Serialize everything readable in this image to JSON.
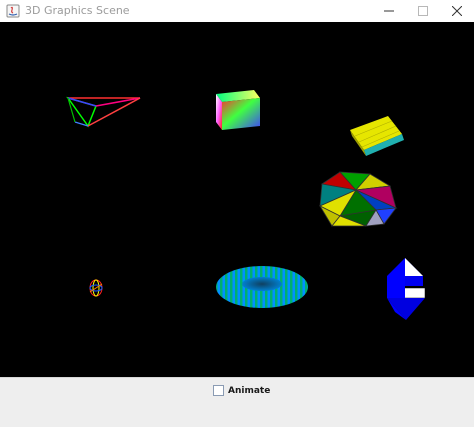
{
  "window": {
    "title": "3D Graphics Scene",
    "buttons": {
      "minimize": "minimize",
      "maximize": "maximize",
      "close": "close"
    }
  },
  "scene": {
    "background": "#000000",
    "objects": [
      {
        "name": "wireframe-pyramid",
        "colors": [
          "#00ff00",
          "#ff0000",
          "#0000ff"
        ]
      },
      {
        "name": "gradient-cube",
        "colors": [
          "#ff0000",
          "#00ff00",
          "#0000ff",
          "#ffffff"
        ]
      },
      {
        "name": "yellow-slab",
        "colors": [
          "#e0e000",
          "#20c0c0"
        ]
      },
      {
        "name": "icosahedron",
        "colors": [
          "#c00000",
          "#00a000",
          "#e0e000",
          "#2040ff"
        ]
      },
      {
        "name": "small-wire-sphere",
        "colors": [
          "#ff0000",
          "#ffff00",
          "#2060ff"
        ]
      },
      {
        "name": "striped-torus",
        "colors": [
          "#00c070",
          "#00a0ff"
        ]
      },
      {
        "name": "blue-capsule",
        "colors": [
          "#0000ff",
          "#ffffff"
        ]
      }
    ]
  },
  "controls": {
    "animate_label": "Animate",
    "animate_checked": false
  }
}
